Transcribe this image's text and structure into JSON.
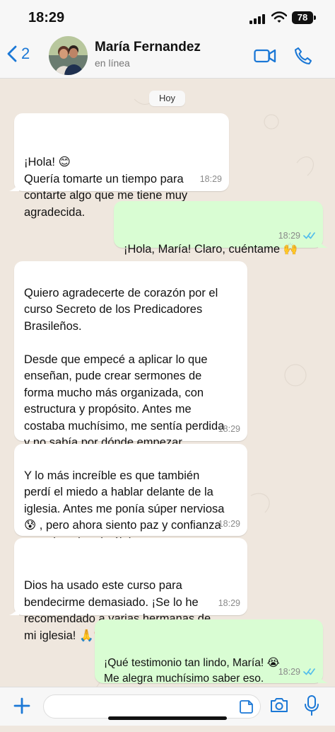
{
  "status_bar": {
    "time": "18:29",
    "battery": "78"
  },
  "header": {
    "back_count": "2",
    "contact_name": "María Fernandez",
    "contact_status": "en línea"
  },
  "chat": {
    "date_label": "Hoy",
    "messages": [
      {
        "direction": "incoming",
        "text": "¡Hola! 😊\nQuería tomarte un tiempo para\ncontarte algo que me tiene muy\nagradecida.",
        "time": "18:29"
      },
      {
        "direction": "outgoing",
        "text": "¡Hola, María! Claro, cuéntame 🙌\n¿Cómo te ha ido?",
        "time": "18:29",
        "read": true
      },
      {
        "direction": "incoming",
        "text": "Quiero agradecerte de corazón por el\ncurso Secreto de los Predicadores\nBrasileños.\n\nDesde que empecé a aplicar lo que\nenseñan, pude crear sermones de\nforma mucho más organizada, con\nestructura y propósito. Antes me\ncostaba muchísimo, me sentía perdida\ny no sabía por dónde empezar.",
        "time": "18:29"
      },
      {
        "direction": "incoming",
        "text": "Y lo más increíble es que también\nperdí el miedo a hablar delante de la\niglesia. Antes me ponía súper nerviosa\n😰 , pero ahora siento paz y confianza\ncuando subo al púlpito.",
        "time": "18:29"
      },
      {
        "direction": "incoming",
        "text": "Dios ha usado este curso para\nbendecirme demasiado. ¡Se lo he\nrecomendado a varias hermanas de\nmi iglesia! 🙏❤️",
        "time": "18:29"
      },
      {
        "direction": "outgoing",
        "text": "¡Qué testimonio tan lindo, María! 😭\nMe alegra muchísimo saber eso.\n¡Que Dios siga usándote grandemente!",
        "time": "18:29",
        "read": true
      }
    ]
  },
  "composer": {
    "placeholder": ""
  },
  "icons": {
    "back": "chevron-left-icon",
    "video": "video-call-icon",
    "phone": "phone-icon",
    "add": "plus-icon",
    "sticker": "sticker-icon",
    "camera": "camera-icon",
    "microphone": "microphone-icon"
  },
  "colors": {
    "accent": "#1b78d6",
    "incoming_bubble": "#ffffff",
    "outgoing_bubble": "#d9fdd3",
    "read_receipt": "#53bdeb",
    "chat_background": "#efe7de"
  }
}
